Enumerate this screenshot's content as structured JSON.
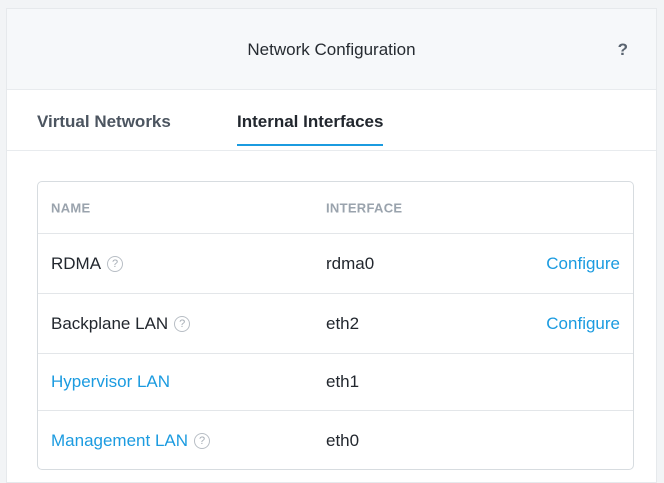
{
  "header": {
    "title": "Network Configuration",
    "help_label": "?"
  },
  "tabs": [
    {
      "label": "Virtual Networks",
      "active": false
    },
    {
      "label": "Internal Interfaces",
      "active": true
    }
  ],
  "table": {
    "columns": [
      "NAME",
      "INTERFACE"
    ],
    "rows": [
      {
        "name": "RDMA",
        "name_is_link": false,
        "has_help": true,
        "interface": "rdma0",
        "action": "Configure"
      },
      {
        "name": "Backplane LAN",
        "name_is_link": false,
        "has_help": true,
        "interface": "eth2",
        "action": "Configure"
      },
      {
        "name": "Hypervisor LAN",
        "name_is_link": true,
        "has_help": false,
        "interface": "eth1",
        "action": ""
      },
      {
        "name": "Management LAN",
        "name_is_link": true,
        "has_help": true,
        "interface": "eth0",
        "action": ""
      }
    ],
    "help_icon_glyph": "?"
  },
  "colors": {
    "accent": "#1b9be0",
    "header_bg": "#f6f8fa",
    "border": "#d7dce0"
  }
}
